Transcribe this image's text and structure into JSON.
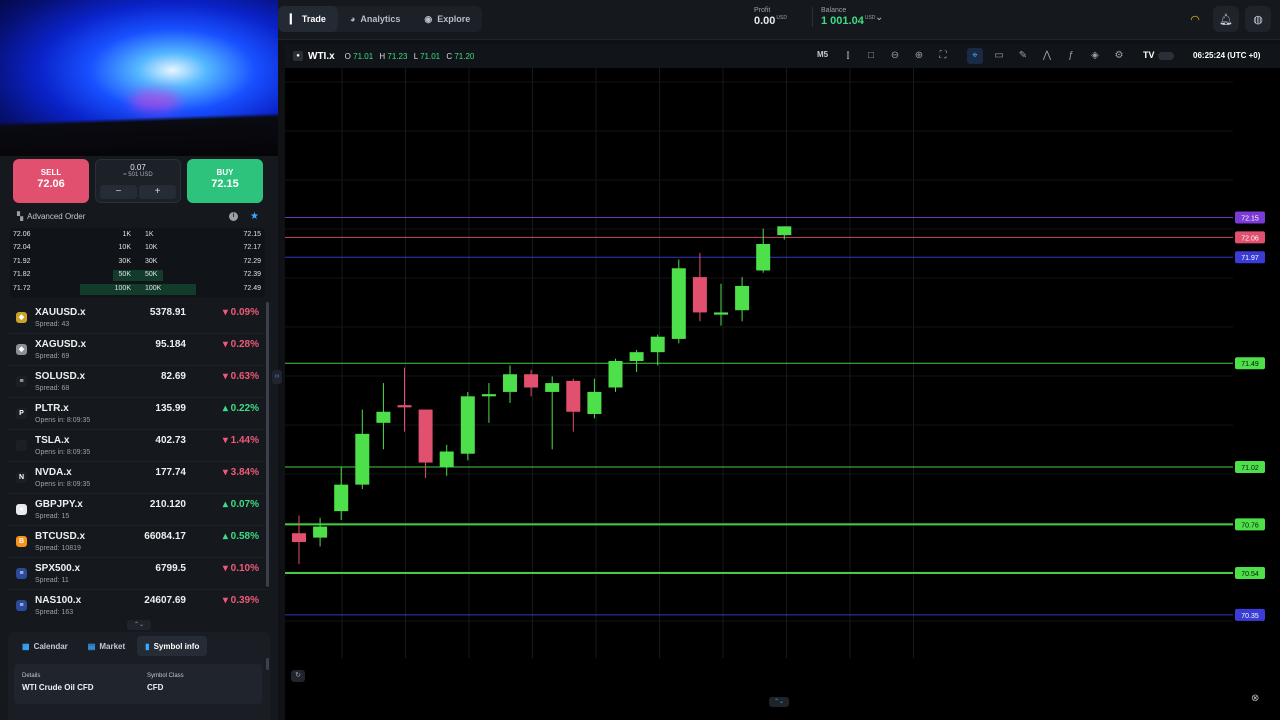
{
  "nav": {
    "tabs": [
      {
        "label": "Trade",
        "icon": "trade-icon",
        "active": true
      },
      {
        "label": "Analytics",
        "icon": "analytics-icon",
        "active": false
      },
      {
        "label": "Explore",
        "icon": "compass-icon",
        "active": false
      }
    ],
    "profit_label": "Profit",
    "profit_value": "0.00",
    "balance_label": "Balance",
    "balance_value": "1 001.04",
    "currency": "USD",
    "accent_green": "#3ddc84"
  },
  "trade_panel": {
    "sell_label": "SELL",
    "sell_price": "72.06",
    "buy_label": "BUY",
    "buy_price": "72.15",
    "volume": "0.07",
    "volume_usd": "≈ 501 USD",
    "minus": "−",
    "plus": "+",
    "advanced_order": "Advanced Order",
    "sell_color": "#e1506e",
    "buy_color": "#2ec37d"
  },
  "depth": [
    {
      "bid": "72.06",
      "bid_size": "1K",
      "ask_size": "1K",
      "ask": "72.15",
      "fill": 0.0
    },
    {
      "bid": "72.04",
      "bid_size": "10K",
      "ask_size": "10K",
      "ask": "72.17",
      "fill": 0.0
    },
    {
      "bid": "71.92",
      "bid_size": "30K",
      "ask_size": "30K",
      "ask": "72.29",
      "fill": 0.0
    },
    {
      "bid": "71.82",
      "bid_size": "50K",
      "ask_size": "50K",
      "ask": "72.39",
      "fill": 0.35
    },
    {
      "bid": "71.72",
      "bid_size": "100K",
      "ask_size": "100K",
      "ask": "72.49",
      "fill": 0.8
    }
  ],
  "symbols": [
    {
      "name": "XAUUSD.x",
      "sub": "Spread: 43",
      "price": "5378.91",
      "change": "0.09%",
      "dir": "down",
      "icon": "gold-icon",
      "icon_color": "#c9a227",
      "glyph": "◆"
    },
    {
      "name": "XAGUSD.x",
      "sub": "Spread: 69",
      "price": "95.184",
      "change": "0.28%",
      "dir": "down",
      "icon": "silver-icon",
      "icon_color": "#8a8f98",
      "glyph": "◆"
    },
    {
      "name": "SOLUSD.x",
      "sub": "Spread: 68",
      "price": "82.69",
      "change": "0.63%",
      "dir": "down",
      "icon": "solana-icon",
      "icon_color": "#1c1f26",
      "glyph": "≡"
    },
    {
      "name": "PLTR.x",
      "sub": "Opens in: 8:09:35",
      "price": "135.99",
      "change": "0.22%",
      "dir": "up",
      "icon": "palantir-icon",
      "icon_color": "#1c1f26",
      "glyph": "P"
    },
    {
      "name": "TSLA.x",
      "sub": "Opens in: 8:09:35",
      "price": "402.73",
      "change": "1.44%",
      "dir": "down",
      "icon": "tesla-icon",
      "icon_color": "#1c1f26",
      "glyph": ""
    },
    {
      "name": "NVDA.x",
      "sub": "Opens in: 8:09:35",
      "price": "177.74",
      "change": "3.84%",
      "dir": "down",
      "icon": "nvidia-icon",
      "icon_color": "#1c1f26",
      "glyph": "N"
    },
    {
      "name": "GBPJPY.x",
      "sub": "Spread: 15",
      "price": "210.120",
      "change": "0.07%",
      "dir": "up",
      "icon": "flag-jp-icon",
      "icon_color": "#e7e9ee",
      "glyph": "●"
    },
    {
      "name": "BTCUSD.x",
      "sub": "Spread: 10819",
      "price": "66084.17",
      "change": "0.58%",
      "dir": "up",
      "icon": "bitcoin-icon",
      "icon_color": "#f7931a",
      "glyph": "B"
    },
    {
      "name": "SPX500.x",
      "sub": "Spread: 11",
      "price": "6799.5",
      "change": "0.10%",
      "dir": "down",
      "icon": "flag-us-icon",
      "icon_color": "#2b4a9c",
      "glyph": "≡"
    },
    {
      "name": "NAS100.x",
      "sub": "Spread: 163",
      "price": "24607.69",
      "change": "0.39%",
      "dir": "down",
      "icon": "flag-us-icon",
      "icon_color": "#2b4a9c",
      "glyph": "≡"
    }
  ],
  "bottom_tabs": [
    {
      "label": "Calendar",
      "icon": "calendar-icon",
      "active": false
    },
    {
      "label": "Market",
      "icon": "market-icon",
      "active": false
    },
    {
      "label": "Symbol info",
      "icon": "info-icon",
      "active": true
    }
  ],
  "symbol_info": {
    "details_label": "Details",
    "details_value": "WTI Crude Oil CFD",
    "class_label": "Symbol Class",
    "class_value": "CFD"
  },
  "chart_header": {
    "symbol": "WTI.x",
    "o_label": "O",
    "o": "71.01",
    "h_label": "H",
    "h": "71.23",
    "l_label": "L",
    "l": "71.01",
    "c_label": "C",
    "c": "71.20",
    "timeframe": "M5",
    "tools": [
      "candles-icon",
      "rectangle-icon",
      "zoom-out-icon",
      "zoom-in-icon",
      "fullscreen-icon",
      "crosshair-icon",
      "ruler-icon",
      "pencil-icon",
      "pattern-icon",
      "indicators-icon",
      "layers-icon",
      "settings-icon"
    ],
    "clock": "06:25:24 (UTC +0)"
  },
  "chart_data": {
    "type": "candlestick",
    "symbol": "WTI.x",
    "timeframe": "M5",
    "ylim": [
      70.2,
      72.8
    ],
    "candles": [
      {
        "o": 70.72,
        "h": 70.8,
        "l": 70.58,
        "c": 70.68
      },
      {
        "o": 70.7,
        "h": 70.79,
        "l": 70.66,
        "c": 70.75
      },
      {
        "o": 70.82,
        "h": 71.02,
        "l": 70.78,
        "c": 70.94
      },
      {
        "o": 70.94,
        "h": 71.28,
        "l": 70.92,
        "c": 71.17
      },
      {
        "o": 71.22,
        "h": 71.4,
        "l": 71.1,
        "c": 71.27
      },
      {
        "o": 71.3,
        "h": 71.47,
        "l": 71.18,
        "c": 71.29
      },
      {
        "o": 71.28,
        "h": 71.28,
        "l": 70.97,
        "c": 71.04
      },
      {
        "o": 71.02,
        "h": 71.12,
        "l": 70.98,
        "c": 71.09
      },
      {
        "o": 71.08,
        "h": 71.36,
        "l": 71.05,
        "c": 71.34
      },
      {
        "o": 71.34,
        "h": 71.4,
        "l": 71.22,
        "c": 71.35
      },
      {
        "o": 71.36,
        "h": 71.48,
        "l": 71.31,
        "c": 71.44
      },
      {
        "o": 71.44,
        "h": 71.46,
        "l": 71.34,
        "c": 71.38
      },
      {
        "o": 71.36,
        "h": 71.43,
        "l": 71.1,
        "c": 71.4
      },
      {
        "o": 71.41,
        "h": 71.42,
        "l": 71.18,
        "c": 71.27
      },
      {
        "o": 71.26,
        "h": 71.42,
        "l": 71.24,
        "c": 71.36
      },
      {
        "o": 71.38,
        "h": 71.51,
        "l": 71.36,
        "c": 71.5
      },
      {
        "o": 71.5,
        "h": 71.55,
        "l": 71.45,
        "c": 71.54
      },
      {
        "o": 71.54,
        "h": 71.62,
        "l": 71.48,
        "c": 71.61
      },
      {
        "o": 71.6,
        "h": 71.96,
        "l": 71.58,
        "c": 71.92
      },
      {
        "o": 71.88,
        "h": 71.99,
        "l": 71.68,
        "c": 71.72
      },
      {
        "o": 71.71,
        "h": 71.85,
        "l": 71.66,
        "c": 71.72
      },
      {
        "o": 71.73,
        "h": 71.88,
        "l": 71.68,
        "c": 71.84
      },
      {
        "o": 71.91,
        "h": 72.1,
        "l": 71.9,
        "c": 72.03
      },
      {
        "o": 72.07,
        "h": 72.11,
        "l": 72.05,
        "c": 72.11
      }
    ],
    "price_lines": [
      {
        "price": 72.15,
        "label": "72.15",
        "color": "#7b3bd6"
      },
      {
        "price": 72.06,
        "label": "72.06",
        "color": "#e1506e"
      },
      {
        "price": 71.97,
        "label": "71.97",
        "color": "#3b3bd6"
      },
      {
        "price": 71.49,
        "label": "71.49",
        "color": "#4ee04a"
      },
      {
        "price": 71.02,
        "label": "71.02",
        "color": "#4ee04a"
      },
      {
        "price": 70.76,
        "label": "70.76",
        "color": "#4ee04a"
      },
      {
        "price": 70.54,
        "label": "70.54",
        "color": "#4ee04a"
      },
      {
        "price": 70.35,
        "label": "70.35",
        "color": "#3b3bd6"
      }
    ],
    "up_color": "#4ee04a",
    "down_color": "#e1506e",
    "grid": true
  }
}
